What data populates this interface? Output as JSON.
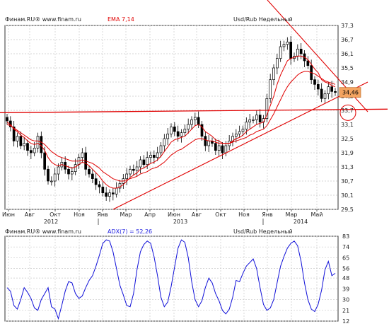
{
  "chart_data": [
    {
      "type": "candlestick",
      "header": {
        "source": "Финам.RU® www.finam.ru",
        "indicator": "EMA 7,14",
        "instrument": "Usd/Rub Недельный"
      },
      "price_tag": "34,46",
      "y_ticks": [
        "37,3",
        "36,7",
        "36,1",
        "35,5",
        "34,9",
        "34,3",
        "33,7",
        "33,1",
        "32,5",
        "31,9",
        "31,3",
        "30,7",
        "30,1",
        "29,5"
      ],
      "ylim": [
        29.5,
        37.3
      ],
      "x_labels": [
        "Июн",
        "Авг",
        "Окт",
        "Ноя",
        "Янв",
        "Мар",
        "Апр",
        "Июн",
        "Авг",
        "Окт",
        "Ноя",
        "Янв",
        "Мар",
        "Май"
      ],
      "year_labels": [
        "2012",
        "2013",
        "2014"
      ],
      "closes": [
        33.25,
        33.0,
        32.4,
        32.6,
        32.2,
        32.3,
        32.0,
        31.9,
        32.1,
        32.6,
        31.9,
        31.2,
        30.7,
        30.7,
        31.0,
        31.3,
        31.5,
        31.2,
        31.0,
        31.1,
        31.4,
        31.7,
        31.9,
        31.2,
        31.0,
        30.8,
        30.55,
        30.45,
        30.2,
        30.05,
        30.2,
        30.15,
        30.4,
        30.6,
        30.8,
        31.0,
        31.2,
        31.15,
        31.3,
        31.6,
        31.4,
        31.7,
        31.8,
        31.7,
        31.9,
        32.2,
        32.5,
        32.7,
        33.0,
        32.8,
        32.6,
        32.75,
        32.9,
        33.1,
        33.3,
        33.4,
        33.1,
        32.6,
        32.2,
        32.4,
        32.3,
        32.0,
        32.2,
        31.9,
        32.2,
        32.4,
        32.6,
        32.7,
        32.8,
        32.9,
        33.2,
        33.3,
        33.3,
        33.5,
        33.2,
        33.35,
        34.2,
        35.0,
        35.5,
        35.9,
        36.4,
        36.5,
        36.6,
        35.9,
        36.0,
        36.3,
        36.1,
        35.8,
        35.6,
        35.0,
        34.8,
        34.6,
        34.2,
        34.4,
        34.7,
        34.5,
        34.46
      ],
      "ema7": [
        33.2,
        33.1,
        32.9,
        32.8,
        32.65,
        32.55,
        32.4,
        32.3,
        32.25,
        32.3,
        32.2,
        32.0,
        31.7,
        31.5,
        31.4,
        31.35,
        31.4,
        31.35,
        31.3,
        31.25,
        31.3,
        31.4,
        31.5,
        31.45,
        31.35,
        31.2,
        31.05,
        30.9,
        30.7,
        30.55,
        30.45,
        30.4,
        30.4,
        30.45,
        30.55,
        30.7,
        30.85,
        30.95,
        31.05,
        31.2,
        31.25,
        31.35,
        31.45,
        31.5,
        31.6,
        31.75,
        31.95,
        32.15,
        32.35,
        32.45,
        32.5,
        32.55,
        32.6,
        32.75,
        32.9,
        33.05,
        33.1,
        33.0,
        32.8,
        32.7,
        32.6,
        32.45,
        32.4,
        32.3,
        32.3,
        32.3,
        32.4,
        32.5,
        32.55,
        32.65,
        32.8,
        32.9,
        33.0,
        33.1,
        33.15,
        33.2,
        33.5,
        33.9,
        34.3,
        34.8,
        35.2,
        35.5,
        35.8,
        35.9,
        35.95,
        36.0,
        36.0,
        35.95,
        35.85,
        35.65,
        35.45,
        35.3,
        35.0,
        34.9,
        34.85,
        34.75,
        34.7
      ],
      "ema14": [
        33.1,
        33.05,
        32.95,
        32.85,
        32.75,
        32.65,
        32.55,
        32.45,
        32.4,
        32.4,
        32.35,
        32.25,
        32.1,
        31.95,
        31.85,
        31.75,
        31.7,
        31.65,
        31.6,
        31.55,
        31.55,
        31.55,
        31.6,
        31.55,
        31.5,
        31.45,
        31.35,
        31.25,
        31.1,
        31.0,
        30.9,
        30.8,
        30.75,
        30.7,
        30.7,
        30.75,
        30.8,
        30.85,
        30.9,
        31.0,
        31.05,
        31.1,
        31.2,
        31.25,
        31.3,
        31.4,
        31.5,
        31.65,
        31.8,
        31.9,
        32.0,
        32.05,
        32.15,
        32.25,
        32.35,
        32.45,
        32.5,
        32.5,
        32.45,
        32.4,
        32.4,
        32.35,
        32.3,
        32.3,
        32.3,
        32.3,
        32.35,
        32.4,
        32.45,
        32.5,
        32.55,
        32.65,
        32.7,
        32.8,
        32.85,
        32.9,
        33.05,
        33.3,
        33.55,
        33.85,
        34.15,
        34.45,
        34.7,
        34.9,
        35.05,
        35.2,
        35.3,
        35.35,
        35.35,
        35.3,
        35.25,
        35.15,
        35.05,
        34.95,
        34.9,
        34.85,
        34.8
      ],
      "annotations": [
        {
          "type": "line",
          "from": [
            "start",
            33.7
          ],
          "to": [
            "end",
            33.8
          ]
        },
        {
          "type": "line",
          "from": [
            "Янв 2013",
            29.5
          ],
          "to": [
            "end",
            34.6
          ]
        },
        {
          "type": "line",
          "from": [
            "Мар 2014",
            37.3
          ],
          "to": [
            "end",
            33.7
          ]
        }
      ]
    },
    {
      "type": "line",
      "header": {
        "source": "Финам.RU® www.finam.ru",
        "indicator": "ADX(7) = 52,26",
        "instrument": "Usd/Rub Недельный"
      },
      "y_ticks": [
        "83",
        "74",
        "65",
        "56",
        "48",
        "39",
        "30",
        "21",
        "12"
      ],
      "ylim": [
        12,
        83
      ],
      "values": [
        40,
        37,
        25,
        22,
        30,
        40,
        36,
        31,
        23,
        21,
        30,
        35,
        40,
        24,
        22,
        14,
        25,
        37,
        45,
        44,
        35,
        31,
        33,
        40,
        46,
        50,
        58,
        67,
        77,
        80,
        79,
        70,
        56,
        42,
        34,
        25,
        24,
        35,
        55,
        70,
        76,
        79,
        77,
        66,
        50,
        32,
        24,
        28,
        41,
        57,
        73,
        80,
        78,
        65,
        45,
        30,
        24,
        29,
        40,
        48,
        44,
        35,
        29,
        21,
        18,
        22,
        32,
        46,
        45,
        52,
        58,
        61,
        64,
        56,
        40,
        26,
        21,
        23,
        30,
        44,
        58,
        66,
        73,
        77,
        79,
        75,
        62,
        44,
        30,
        22,
        20,
        26,
        38,
        55,
        62,
        50,
        52
      ]
    }
  ]
}
